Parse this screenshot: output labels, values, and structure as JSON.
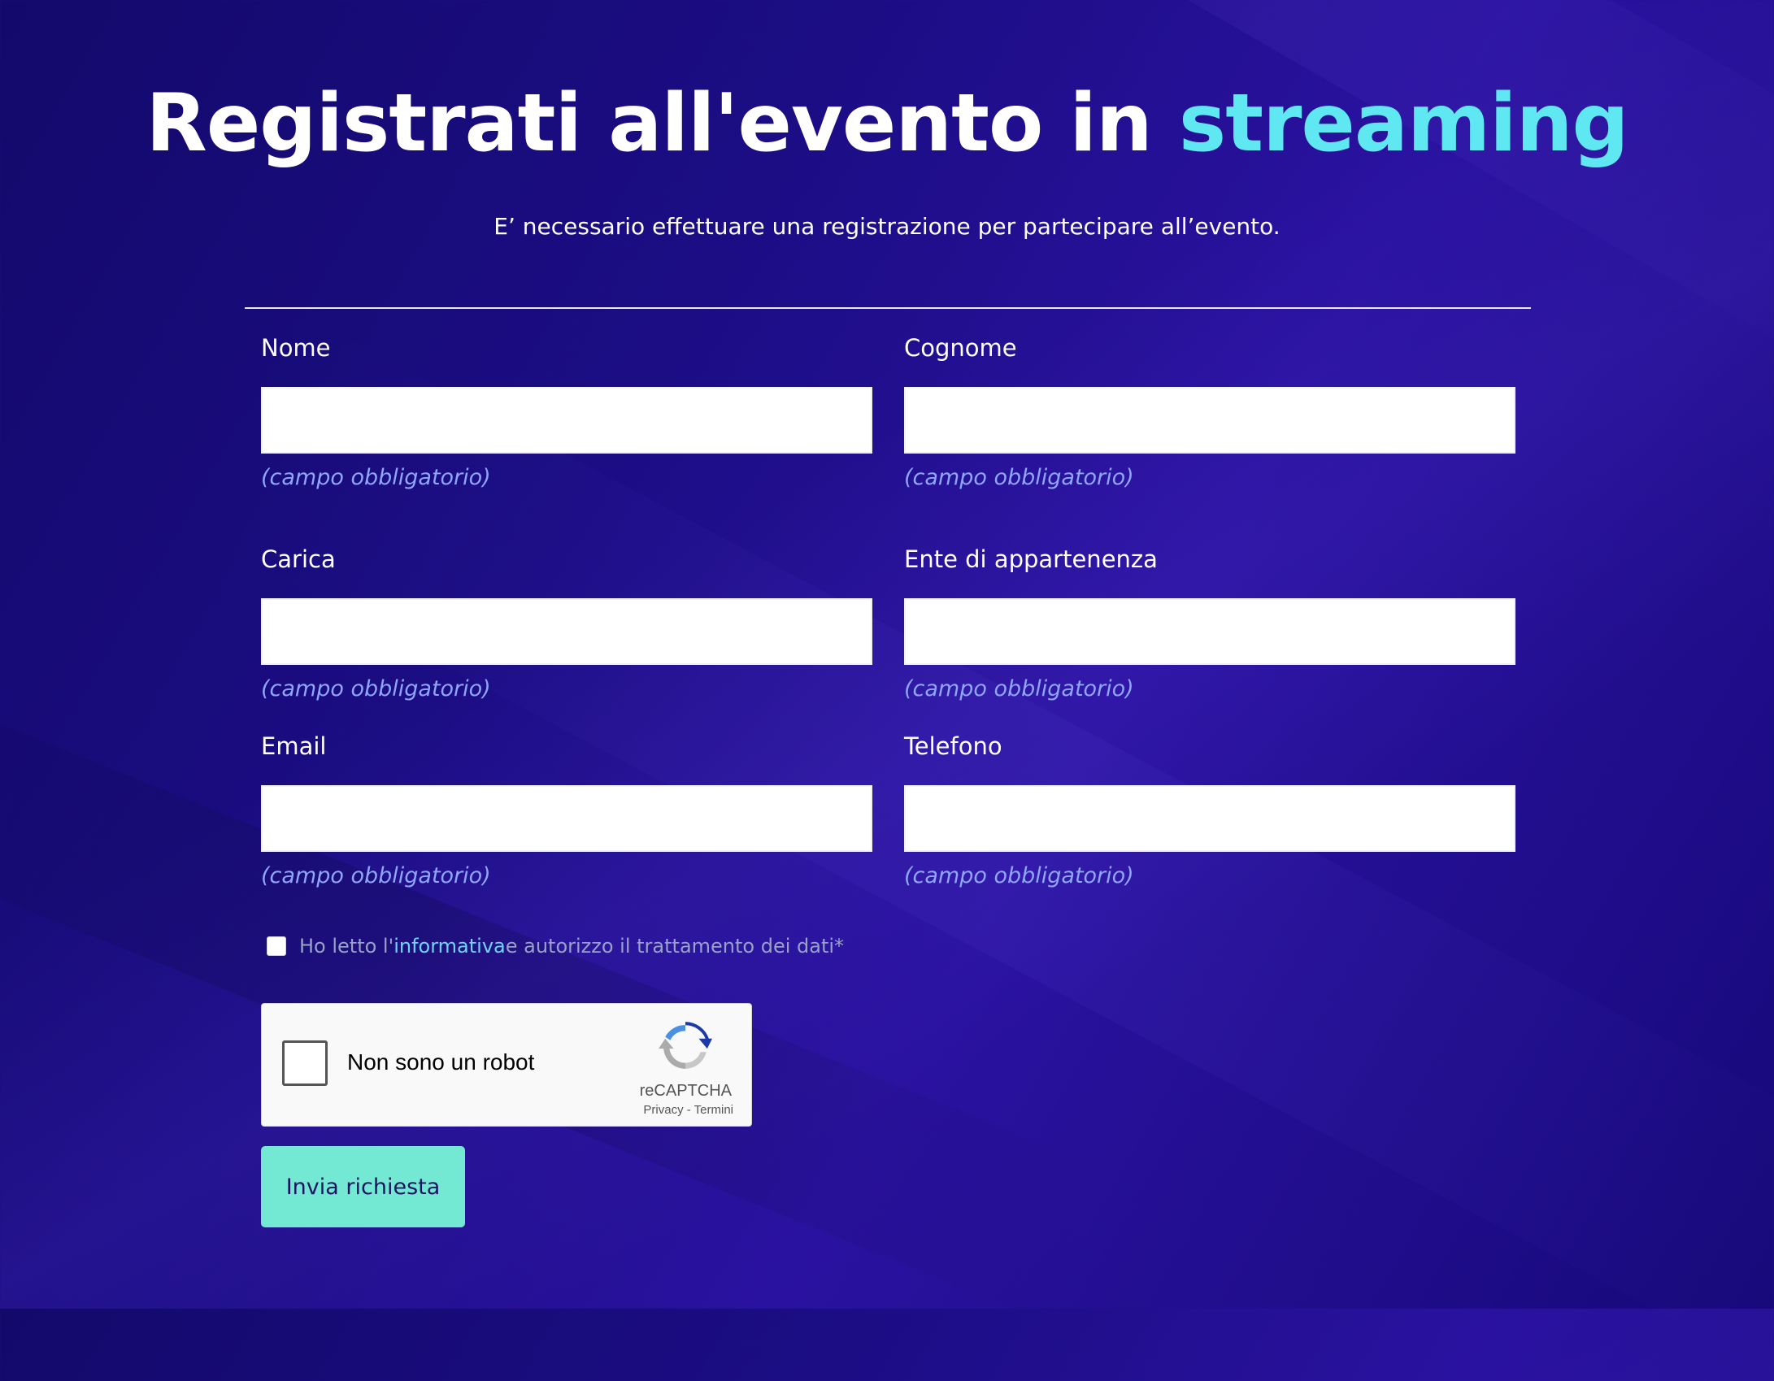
{
  "header": {
    "title_main": "Registrati all'evento in ",
    "title_accent": "streaming",
    "subtitle": "E’ necessario effettuare una registrazione per partecipare all’evento."
  },
  "form": {
    "fields": [
      {
        "label": "Nome",
        "value": "",
        "hint": "(campo obbligatorio)"
      },
      {
        "label": "Cognome",
        "value": "",
        "hint": "(campo obbligatorio)"
      },
      {
        "label": "Carica",
        "value": "",
        "hint": "(campo obbligatorio)"
      },
      {
        "label": "Ente di appartenenza",
        "value": "",
        "hint": "(campo obbligatorio)"
      },
      {
        "label": "Email",
        "value": "",
        "hint": "(campo obbligatorio)"
      },
      {
        "label": "Telefono",
        "value": "",
        "hint": "(campo obbligatorio)"
      }
    ],
    "consent": {
      "prefix": "Ho letto l'",
      "link": "informativa",
      "suffix": " e autorizzo il trattamento dei dati*",
      "checked": false
    },
    "recaptcha": {
      "label": "Non sono un robot",
      "brand": "reCAPTCHA",
      "links": "Privacy - Termini",
      "checked": false
    },
    "submit_label": "Invia richiesta"
  },
  "colors": {
    "background": "#1a0b7a",
    "accent": "#5fe7f2",
    "hint": "#8fa6ff",
    "submit": "#73e8d3",
    "link": "#6fd5ff"
  },
  "icons": [
    "recaptcha-logo-icon",
    "checkbox-icon"
  ]
}
